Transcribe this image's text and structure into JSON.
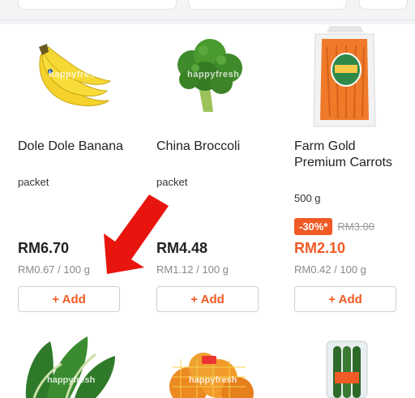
{
  "products": [
    {
      "name": "Dole Dole Banana",
      "unit": "packet",
      "price": "RM6.70",
      "per_unit": "RM0.67 / 100 g",
      "add_label": "+ Add",
      "watermark": "happyfresh",
      "image_icon": "banana-image"
    },
    {
      "name": "China Broccoli",
      "unit": "packet",
      "price": "RM4.48",
      "per_unit": "RM1.12 / 100 g",
      "add_label": "+ Add",
      "watermark": "happyfresh",
      "image_icon": "broccoli-image"
    },
    {
      "name": "Farm Gold Premium Carrots",
      "unit": "500 g",
      "discount": "-30%*",
      "old_price": "RM3.00",
      "price": "RM2.10",
      "per_unit": "RM0.42 / 100 g",
      "add_label": "+ Add",
      "image_icon": "carrots-image"
    }
  ],
  "row2": {
    "watermark": "happyfresh",
    "images": [
      "leafy-greens-image",
      "oranges-net-image",
      "cucumber-pack-image"
    ]
  },
  "colors": {
    "accent": "#f15a24",
    "arrow": "#e8140e",
    "muted": "#8a8a8a"
  }
}
